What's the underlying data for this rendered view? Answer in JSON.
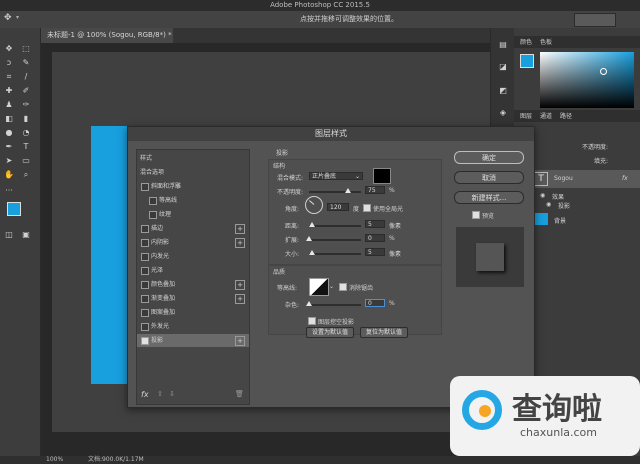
{
  "app": {
    "title": "Adobe Photoshop CC 2015.5"
  },
  "options": {
    "hint": "点按并拖移可调整效果的位置。"
  },
  "document": {
    "tab": "未标题-1 @ 100% (Sogou, RGB/8*) *"
  },
  "status": {
    "zoom": "100%",
    "doc_info": "文档:900.0K/1.17M"
  },
  "right_panel": {
    "color_tabs": [
      "颜色",
      "色板"
    ],
    "layer_tabs": [
      "图层",
      "通道",
      "路径"
    ],
    "opacity_label": "不透明度:",
    "fill_label": "填充:",
    "layers": [
      {
        "name": "Sogou",
        "type": "text",
        "fx": "fx"
      },
      {
        "name": "效果",
        "type": "effect-group"
      },
      {
        "name": "投影",
        "type": "effect"
      },
      {
        "name": "背景",
        "type": "background"
      }
    ]
  },
  "dialog": {
    "title": "图层样式",
    "styles_header": "样式",
    "blend_options": "混合选项",
    "items": [
      {
        "label": "斜面和浮雕",
        "checked": false,
        "indent": 0,
        "plus": false
      },
      {
        "label": "等高线",
        "checked": false,
        "indent": 1,
        "plus": false
      },
      {
        "label": "纹理",
        "checked": false,
        "indent": 1,
        "plus": false
      },
      {
        "label": "描边",
        "checked": false,
        "indent": 0,
        "plus": true
      },
      {
        "label": "内阴影",
        "checked": false,
        "indent": 0,
        "plus": true
      },
      {
        "label": "内发光",
        "checked": false,
        "indent": 0,
        "plus": false
      },
      {
        "label": "光泽",
        "checked": false,
        "indent": 0,
        "plus": false
      },
      {
        "label": "颜色叠加",
        "checked": false,
        "indent": 0,
        "plus": true
      },
      {
        "label": "渐变叠加",
        "checked": false,
        "indent": 0,
        "plus": true
      },
      {
        "label": "图案叠加",
        "checked": false,
        "indent": 0,
        "plus": false
      },
      {
        "label": "外发光",
        "checked": false,
        "indent": 0,
        "plus": false
      },
      {
        "label": "投影",
        "checked": true,
        "indent": 0,
        "plus": true,
        "selected": true
      }
    ],
    "fx_label": "fx",
    "shadow": {
      "section_title": "投影",
      "structure_title": "结构",
      "blend_mode_label": "混合模式:",
      "blend_mode_value": "正片叠底",
      "opacity_label": "不透明度:",
      "opacity_value": "75",
      "angle_label": "角度:",
      "angle_value": "120",
      "angle_unit": "度",
      "global_light_label": "使用全局光",
      "distance_label": "距离:",
      "distance_value": "5",
      "spread_label": "扩展:",
      "spread_value": "0",
      "size_label": "大小:",
      "size_value": "5",
      "px_unit": "像素",
      "pct_unit": "%",
      "quality_title": "品质",
      "contour_label": "等高线:",
      "anti_alias_label": "消除锯齿",
      "noise_label": "杂色:",
      "noise_value": "0",
      "knockout_label": "图层挖空投影",
      "make_default": "设置为默认值",
      "reset_default": "复位为默认值"
    },
    "buttons": {
      "ok": "确定",
      "cancel": "取消",
      "new_style": "新建样式...",
      "preview": "预览"
    }
  },
  "watermark": {
    "brand": "查询啦",
    "url": "chaxunla.com"
  },
  "colors": {
    "accent_blue": "#189fde",
    "dialog_bg": "#535353"
  },
  "levels": {
    "opacity": 0.75,
    "distance_frac": 0.05,
    "spread_frac": 0.0,
    "size_frac": 0.05,
    "noise_frac": 0.0
  }
}
